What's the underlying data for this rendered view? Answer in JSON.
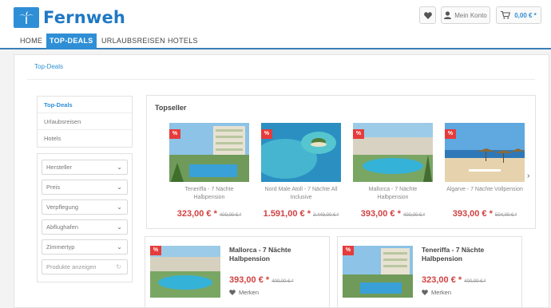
{
  "brand": {
    "name": "Fernweh",
    "accent": "#2f8fd6",
    "price_color": "#d14242",
    "badge_color": "#e63b3b"
  },
  "header": {
    "account_label": "Mein Konto",
    "cart_amount": "0,00 € *"
  },
  "nav": {
    "items": [
      "HOME",
      "TOP-DEALS",
      "URLAUBSREISEN",
      "HOTELS"
    ],
    "active": "TOP-DEALS"
  },
  "breadcrumb": "Top-Deals",
  "sidebar": {
    "categories": [
      "Top-Deals",
      "Urlaubsreisen",
      "Hotels"
    ],
    "filters": [
      "Hersteller",
      "Preis",
      "Verpflegung",
      "Abflughafen",
      "Zimmertyp"
    ],
    "show_button": "Produkte anzeigen"
  },
  "topseller": {
    "title": "Topseller",
    "badge": "%",
    "items": [
      {
        "name": "Teneriffa - 7 Nächte Halbpension",
        "price": "323,00 € *",
        "old_price": "400,00 € *"
      },
      {
        "name": "Nord Male Atoll - 7 Nächte All Inclusive",
        "price": "1.591,00 € *",
        "old_price": "2.449,00 € *"
      },
      {
        "name": "Mallorca - 7 Nächte Halbpension",
        "price": "393,00 € *",
        "old_price": "400,00 € *"
      },
      {
        "name": "Algarve - 7 Nächte Vollpension",
        "price": "393,00 € *",
        "old_price": "504,00 € *"
      }
    ]
  },
  "cards": [
    {
      "name": "Mallorca - 7 Nächte Halbpension",
      "price": "393,00 € *",
      "old_price": "400,00 € *",
      "merken": "Merken"
    },
    {
      "name": "Teneriffa - 7 Nächte Halbpension",
      "price": "323,00 € *",
      "old_price": "400,00 € *",
      "merken": "Merken"
    }
  ],
  "icons": [
    "heart-icon",
    "user-icon",
    "cart-icon",
    "chevron-down-icon",
    "reload-icon",
    "chevron-right-icon",
    "palm-logo-icon"
  ]
}
